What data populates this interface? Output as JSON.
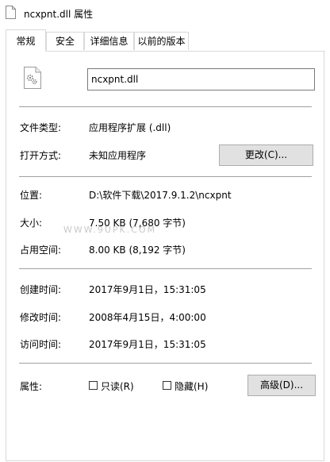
{
  "window": {
    "title": "ncxpnt.dll 属性"
  },
  "tabs": [
    {
      "label": "常规"
    },
    {
      "label": "安全"
    },
    {
      "label": "详细信息"
    },
    {
      "label": "以前的版本"
    }
  ],
  "general": {
    "file_name": "ncxpnt.dll",
    "type_label": "文件类型:",
    "type_value": "应用程序扩展 (.dll)",
    "open_label": "打开方式:",
    "open_value": "未知应用程序",
    "change_button": "更改(C)...",
    "location_label": "位置:",
    "location_value": "D:\\软件下载\\2017.9.1.2\\ncxpnt",
    "size_label": "大小:",
    "size_value": "7.50 KB (7,680 字节)",
    "disk_label": "占用空间:",
    "disk_value": "8.00 KB (8,192 字节)",
    "created_label": "创建时间:",
    "created_value": "2017年9月1日，15:31:05",
    "modified_label": "修改时间:",
    "modified_value": "2008年4月15日，4:00:00",
    "accessed_label": "访问时间:",
    "accessed_value": "2017年9月1日，15:31:05",
    "attr_label": "属性:",
    "readonly_label": "只读(R)",
    "hidden_label": "隐藏(H)",
    "advanced_button": "高级(D)...",
    "readonly_checked": false,
    "hidden_checked": false
  },
  "watermark": "WWW.9UPK.COM",
  "icons": {
    "title": "file-icon",
    "file": "dll-gear-file-icon"
  }
}
